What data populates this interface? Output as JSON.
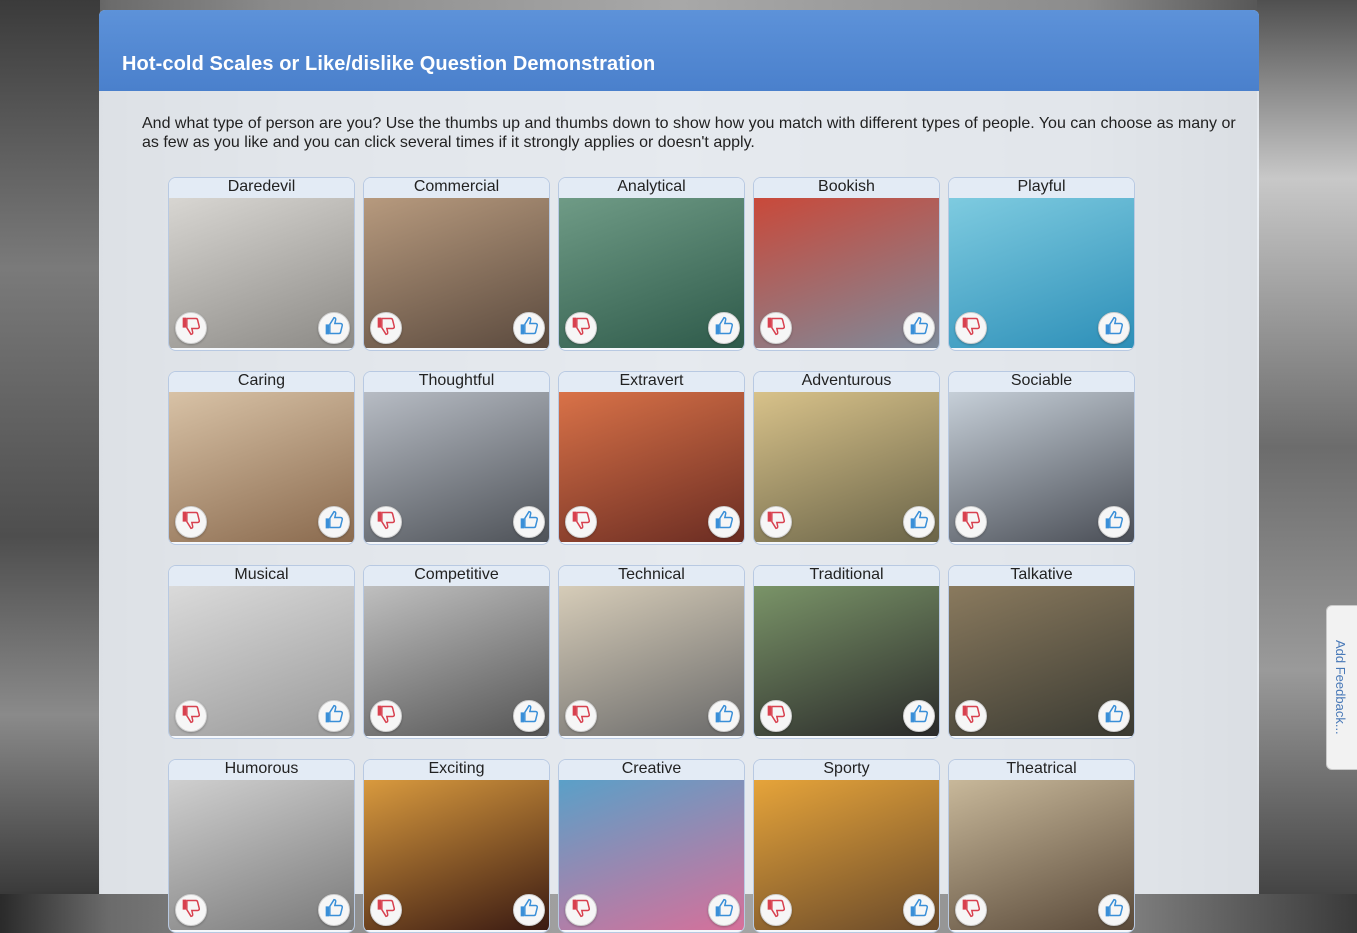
{
  "page": {
    "title": "Hot-cold Scales or Like/dislike Question Demonstration",
    "intro": "And what type of person are you? Use the thumbs up and thumbs down to show how you match with different types of people. You can choose as many or as few as you like and you can click several times if it strongly applies or doesn't apply."
  },
  "feedback": {
    "label": "Add Feedback..."
  },
  "colors": {
    "header": "#4a80cc",
    "thumb_up": "#3a8fd8",
    "thumb_down": "#d8414f"
  },
  "icons": {
    "like": "thumbs-up-icon",
    "dislike": "thumbs-down-icon"
  },
  "cards": [
    {
      "label": "Daredevil",
      "tone": [
        "#d8d6d2",
        "#8c8a86"
      ]
    },
    {
      "label": "Commercial",
      "tone": [
        "#b79a7e",
        "#5b4a3e"
      ]
    },
    {
      "label": "Analytical",
      "tone": [
        "#6f9b86",
        "#2e5a4a"
      ]
    },
    {
      "label": "Bookish",
      "tone": [
        "#c9493a",
        "#7e8a9a"
      ]
    },
    {
      "label": "Playful",
      "tone": [
        "#7ecbe0",
        "#2d8fb8"
      ]
    },
    {
      "label": "Caring",
      "tone": [
        "#d8c2a6",
        "#8a6a4e"
      ]
    },
    {
      "label": "Thoughtful",
      "tone": [
        "#b7bcc4",
        "#4e5258"
      ]
    },
    {
      "label": "Extravert",
      "tone": [
        "#d97248",
        "#6a2c22"
      ]
    },
    {
      "label": "Adventurous",
      "tone": [
        "#d8c28a",
        "#6a6448"
      ]
    },
    {
      "label": "Sociable",
      "tone": [
        "#c6cfd8",
        "#4a4e56"
      ]
    },
    {
      "label": "Musical",
      "tone": [
        "#dadada",
        "#9a9a9a"
      ]
    },
    {
      "label": "Competitive",
      "tone": [
        "#bfbfbf",
        "#555555"
      ]
    },
    {
      "label": "Technical",
      "tone": [
        "#d6ccb8",
        "#6a6a6a"
      ]
    },
    {
      "label": "Traditional",
      "tone": [
        "#7a9468",
        "#2a2a2a"
      ]
    },
    {
      "label": "Talkative",
      "tone": [
        "#8a7a5e",
        "#3a3a32"
      ]
    },
    {
      "label": "Humorous",
      "tone": [
        "#cfcfcf",
        "#7a7a7a"
      ]
    },
    {
      "label": "Exciting",
      "tone": [
        "#d99a3e",
        "#3a1a12"
      ]
    },
    {
      "label": "Creative",
      "tone": [
        "#5aa0c8",
        "#d6709a"
      ]
    },
    {
      "label": "Sporty",
      "tone": [
        "#e6a43a",
        "#6a4a2a"
      ]
    },
    {
      "label": "Theatrical",
      "tone": [
        "#c8b89a",
        "#5a4a3a"
      ]
    }
  ]
}
